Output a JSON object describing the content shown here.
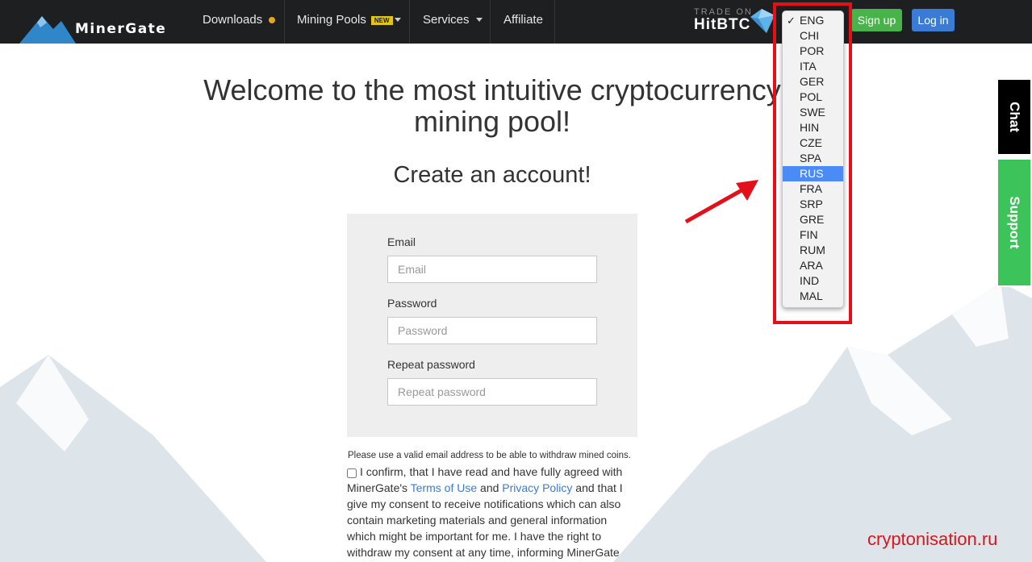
{
  "brand": {
    "name": "MinerGate"
  },
  "nav": {
    "downloads": "Downloads",
    "mining_pools": "Mining Pools",
    "mining_pools_badge": "NEW",
    "services": "Services",
    "affiliate": "Affiliate"
  },
  "trade": {
    "line1": "TRADE ON",
    "line2": "HitBTC"
  },
  "auth": {
    "signup": "Sign up",
    "login": "Log in"
  },
  "languages": {
    "selected": "ENG",
    "highlighted": "RUS",
    "items": [
      "ENG",
      "CHI",
      "POR",
      "ITA",
      "GER",
      "POL",
      "SWE",
      "HIN",
      "CZE",
      "SPA",
      "RUS",
      "FRA",
      "SRP",
      "GRE",
      "FIN",
      "RUM",
      "ARA",
      "IND",
      "MAL"
    ]
  },
  "side_tabs": {
    "chat": "Chat",
    "support": "Support"
  },
  "headline": "Welcome to the most intuitive cryptocurrency mining pool!",
  "subheadline": "Create an account!",
  "form": {
    "email_label": "Email",
    "email_placeholder": "Email",
    "password_label": "Password",
    "password_placeholder": "Password",
    "repeat_label": "Repeat password",
    "repeat_placeholder": "Repeat password"
  },
  "note": "Please use a valid email address to be able to withdraw mined coins.",
  "consent": {
    "part1": "I confirm, that I have read and have fully agreed with MinerGate's ",
    "terms": "Terms of Use",
    "and": " and ",
    "privacy": "Privacy Policy",
    "part2": " and that I give my consent to receive notifications which can also contain marketing materials and general information which might be important for me. I have the right to withdraw my consent at any time, informing MinerGate"
  },
  "watermark": "cryptonisation.ru",
  "colors": {
    "topbar": "#1d1f21",
    "signup": "#48b349",
    "login": "#3a7bd5",
    "support": "#3cc45a",
    "highlight": "#4b8bf5",
    "annotation": "#e3101a"
  }
}
